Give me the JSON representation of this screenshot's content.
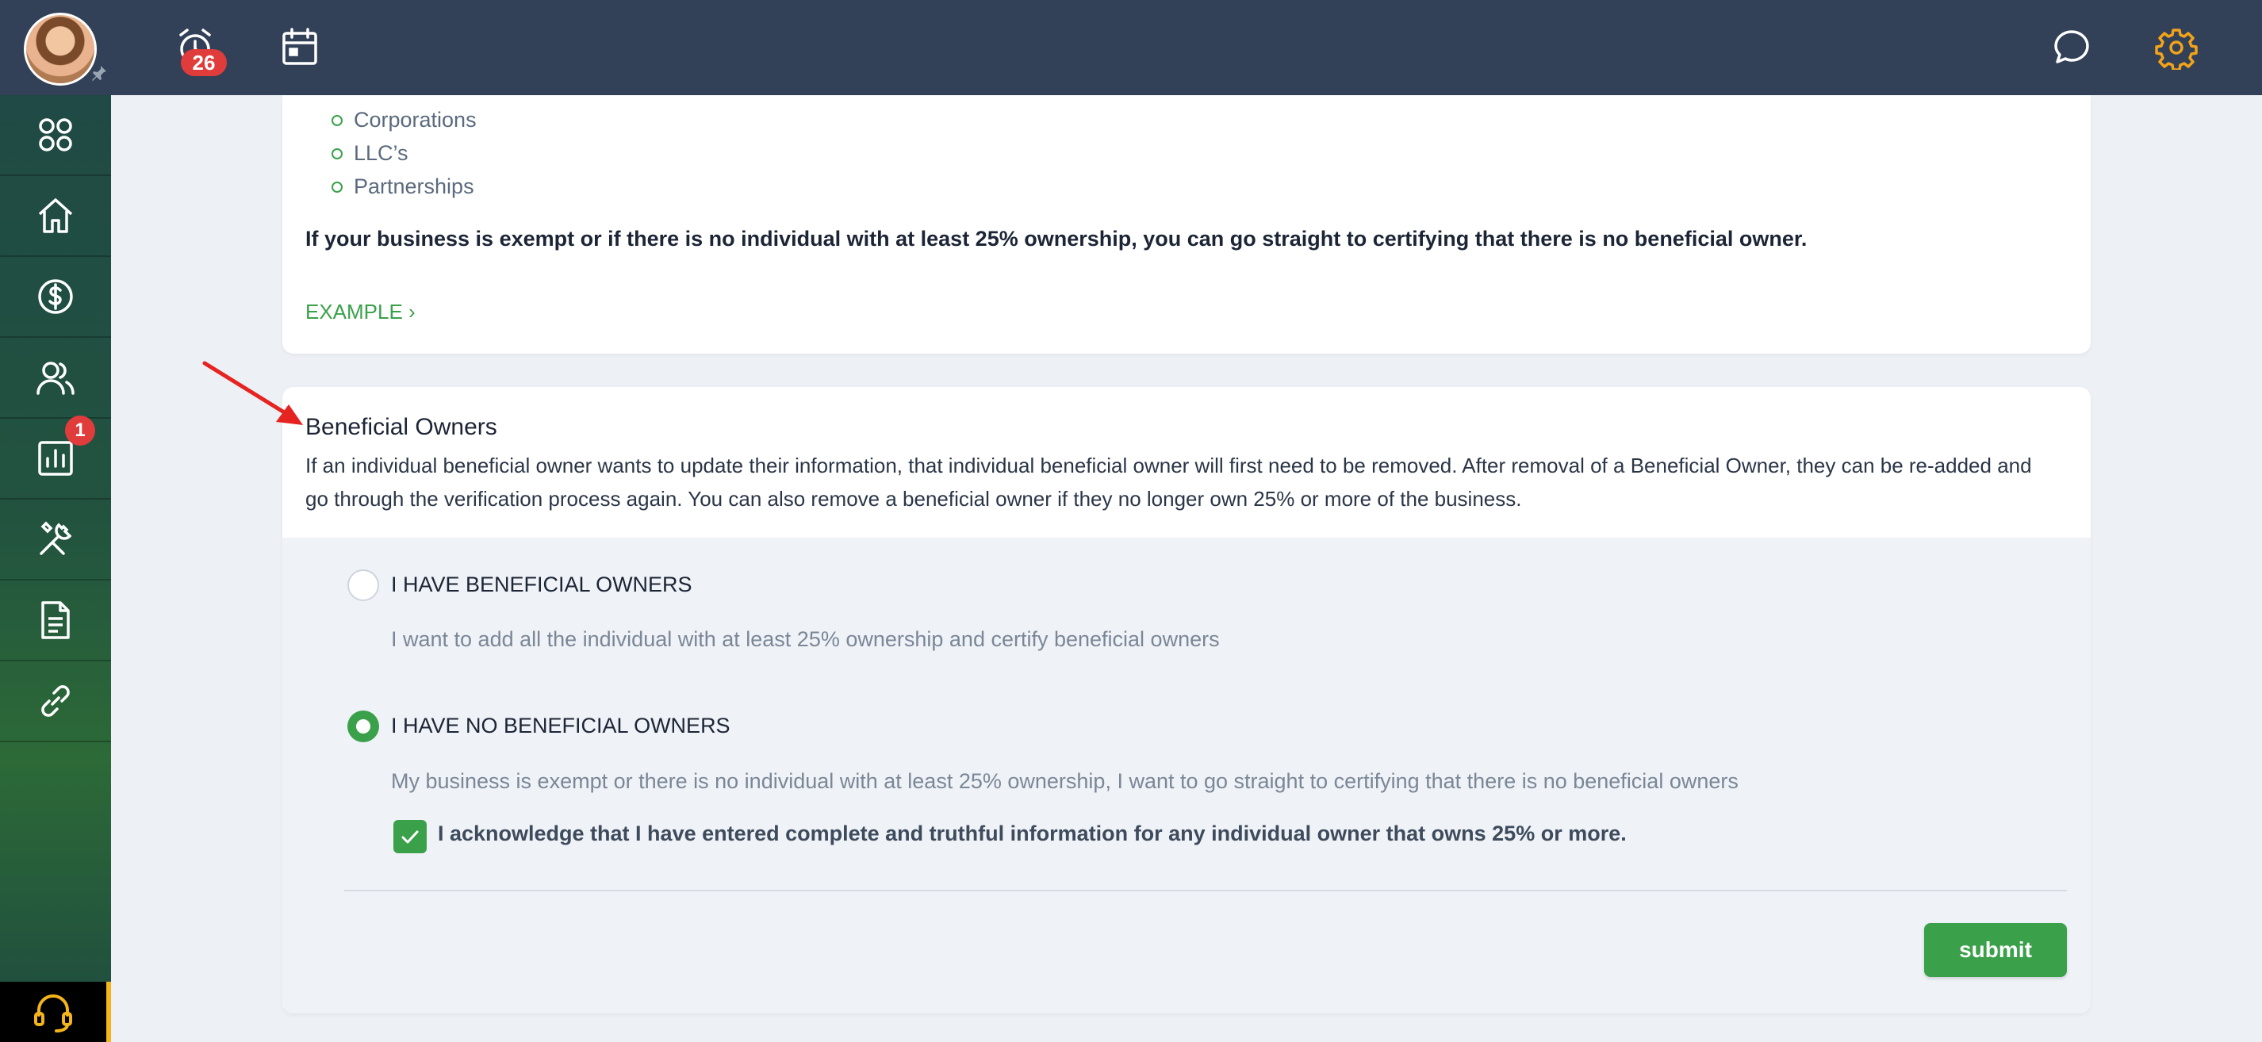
{
  "topbar": {
    "alarm_badge": "26",
    "icons": [
      "avatar",
      "pin-icon",
      "alarm-clock-icon",
      "calendar-icon",
      "chat-icon",
      "gear-icon"
    ]
  },
  "sidebar": {
    "items": [
      "dashboard-icon",
      "home-icon",
      "dollar-icon",
      "users-icon",
      "reports-icon",
      "tools-icon",
      "document-icon",
      "link-icon"
    ],
    "tools_badge": "1",
    "support_icon": "headset-icon"
  },
  "exempt_section": {
    "bullets": [
      "Corporations",
      "LLC’s",
      "Partnerships"
    ],
    "notice": "If your business is exempt or if there is no individual with at least 25% ownership, you can go straight to certifying that there is no beneficial owner.",
    "example_link": "EXAMPLE ›"
  },
  "beneficial_owners": {
    "title": "Beneficial Owners",
    "description": "If an individual beneficial owner wants to update their information, that individual beneficial owner will first need to be removed. After removal of a Beneficial Owner, they can be re-added and go through the verification process again. You can also remove a beneficial owner if they no longer own 25% or more of the business.",
    "options": [
      {
        "label": "I HAVE BENEFICIAL OWNERS",
        "description": "I want to add all the individual with at least 25% ownership and certify beneficial owners",
        "selected": false
      },
      {
        "label": "I HAVE NO BENEFICIAL OWNERS",
        "description": "My business is exempt or there is no individual with at least 25% ownership, I want to go straight to certifying that there is no beneficial owners",
        "selected": true
      }
    ],
    "acknowledgement": "I acknowledge that I have entered complete and truthful information for any individual owner that owns 25% or more.",
    "acknowledged": true,
    "submit_label": "submit"
  },
  "colors": {
    "topbar": "#324157",
    "accent_green": "#3aa14a",
    "badge_red": "#e03c3c",
    "gear_orange": "#f3a31a"
  }
}
